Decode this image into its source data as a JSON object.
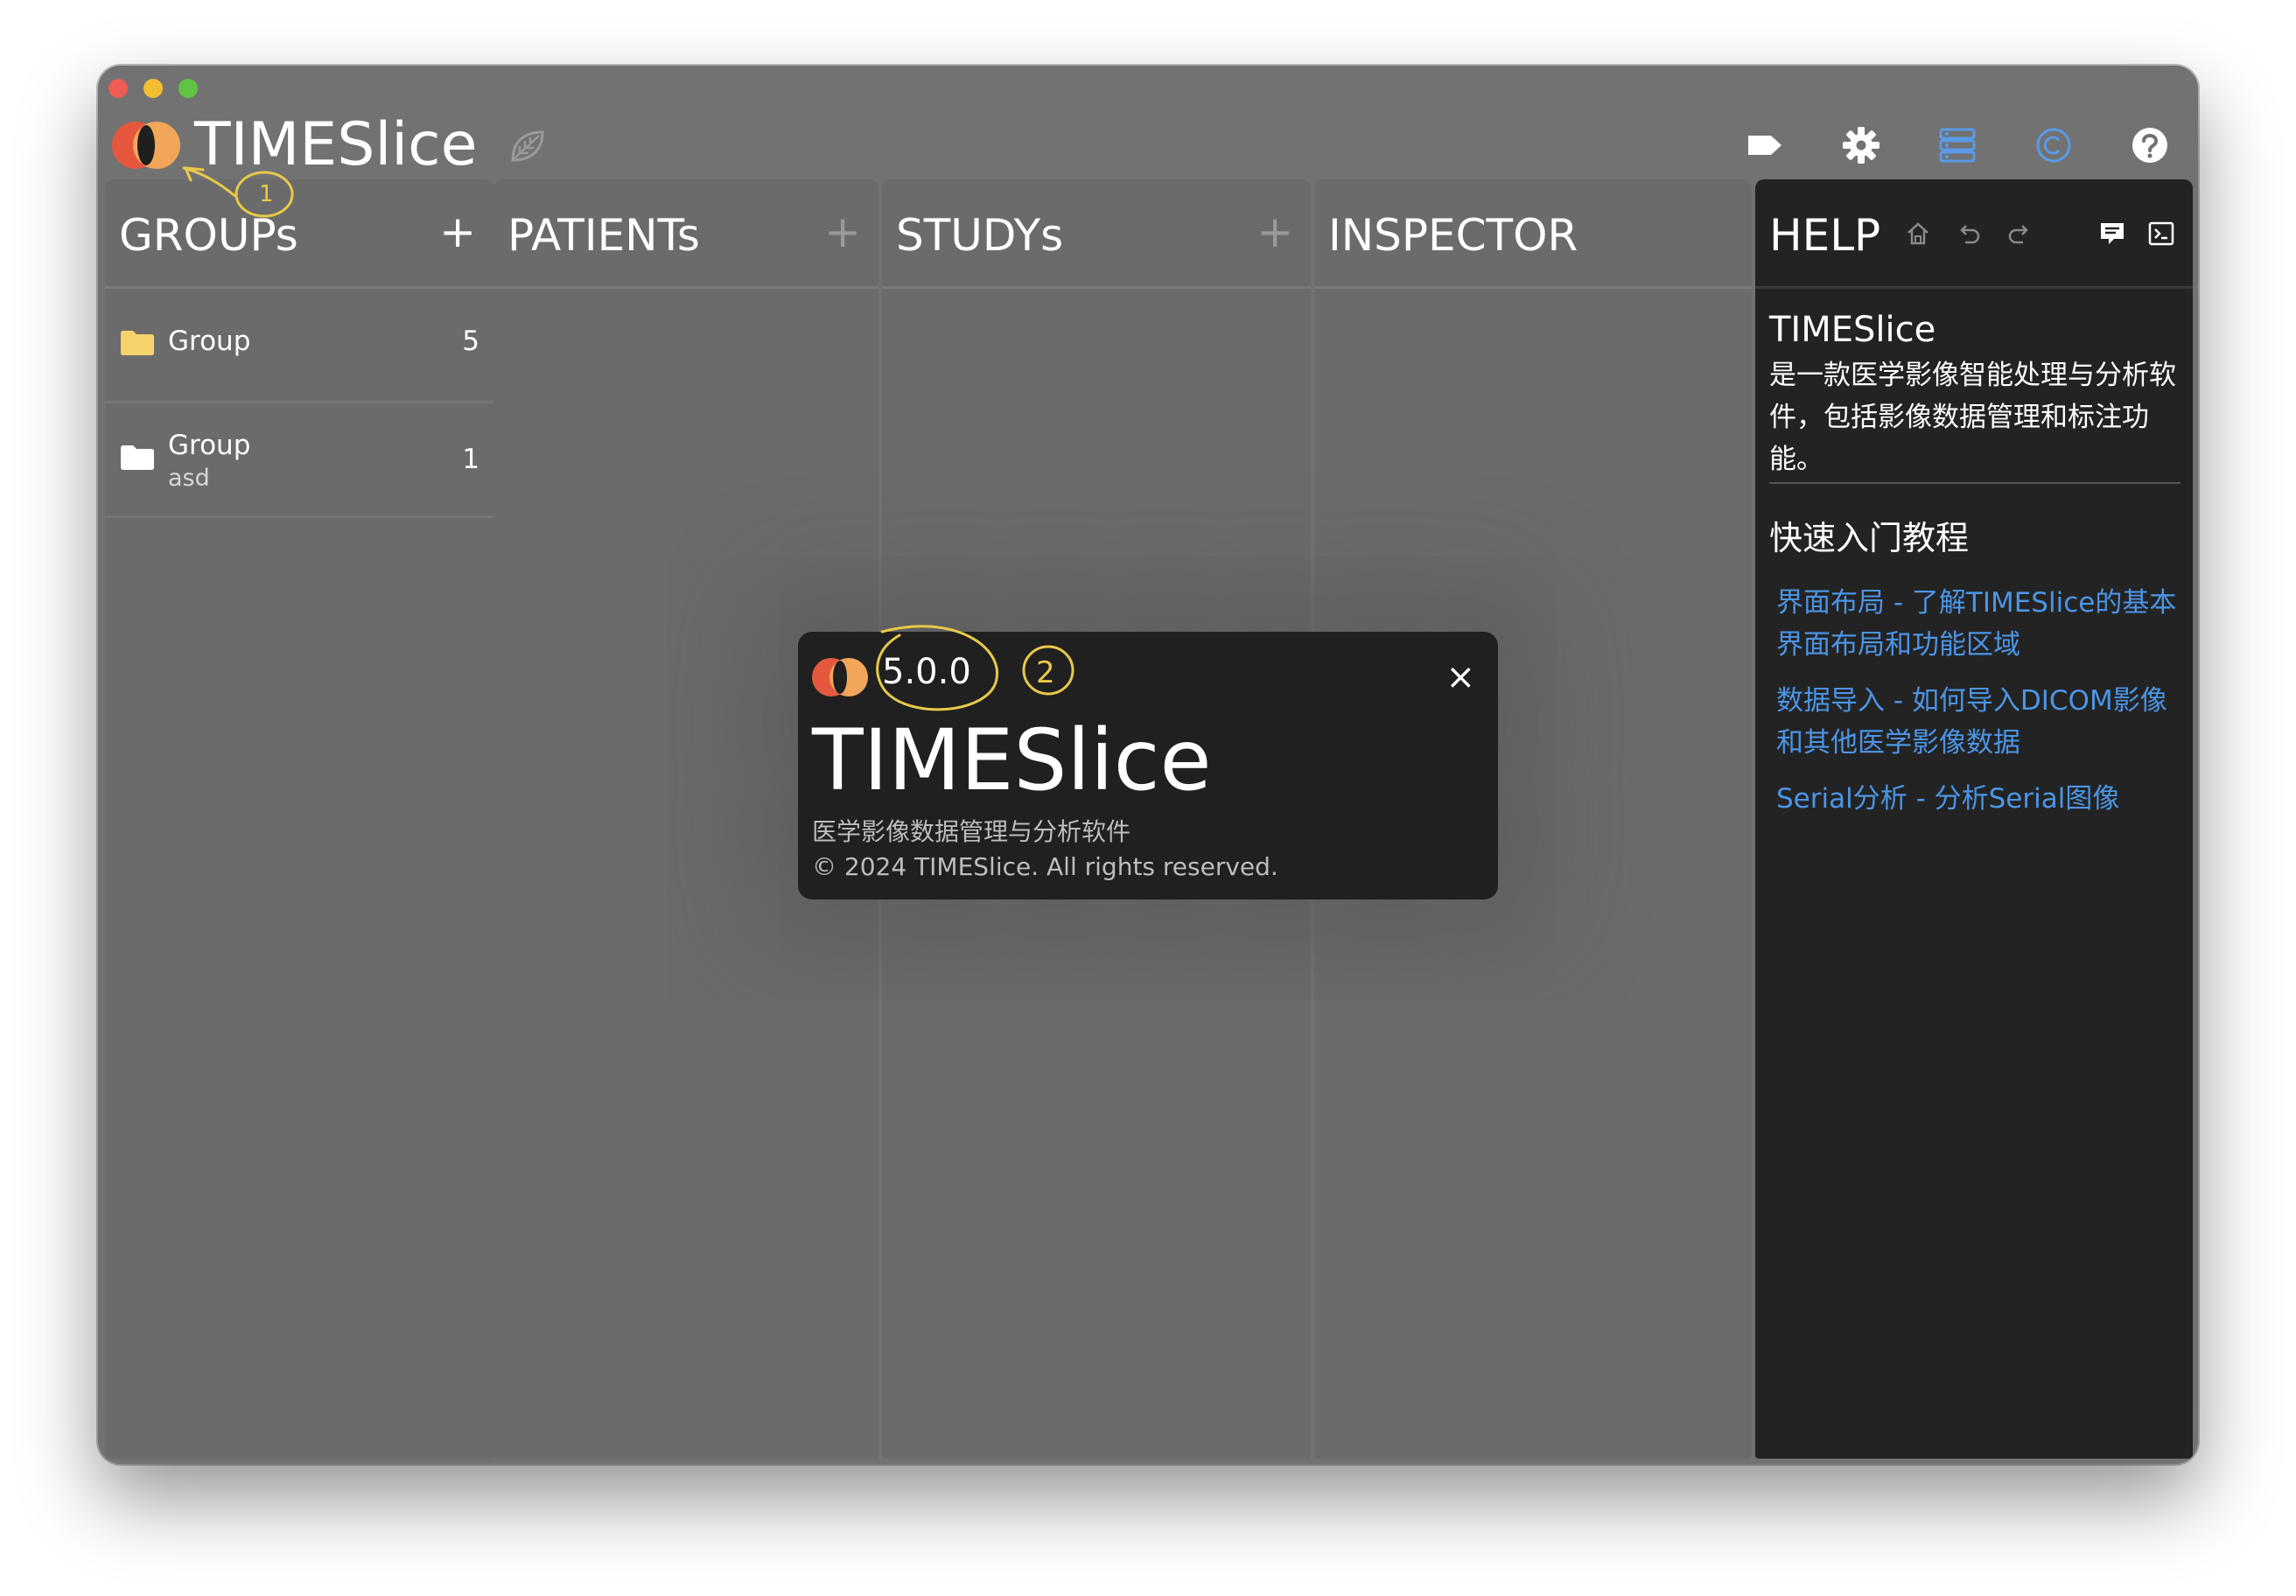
{
  "app": {
    "title": "TIMESlice"
  },
  "toolbar": {
    "items": [
      {
        "icon": "tag-icon"
      },
      {
        "icon": "gear-icon"
      },
      {
        "icon": "server-icon"
      },
      {
        "icon": "copyright-icon"
      },
      {
        "icon": "help-icon"
      }
    ]
  },
  "columns": {
    "groups": {
      "title": "GROUPs",
      "add": "+"
    },
    "patients": {
      "title": "PATIENTs",
      "add": "+"
    },
    "studys": {
      "title": "STUDYs",
      "add": "+"
    },
    "inspector": {
      "title": "INSPECTOR"
    }
  },
  "groups": [
    {
      "name": "Group",
      "count": "5",
      "folder_color": "#f7d36b"
    },
    {
      "name": "Group",
      "sub": "asd",
      "count": "1",
      "folder_color": "#ffffff"
    }
  ],
  "help": {
    "title": "HELP",
    "app_name": "TIMESlice",
    "description": "是一款医学影像智能处理与分析软件，包括影像数据管理和标注功能。",
    "quickstart_title": "快速入门教程",
    "links": [
      "界面布局 - 了解TIMESlice的基本界面布局和功能区域",
      "数据导入 - 如何导入DICOM影像和其他医学影像数据",
      "Serial分析 - 分析Serial图像"
    ]
  },
  "about": {
    "version": "5.0.0",
    "name": "TIMESlice",
    "subtitle": "医学影像数据管理与分析软件",
    "copyright": "© 2024 TIMESlice. All rights reserved.",
    "close": "×"
  },
  "annotations": {
    "mark1": "1",
    "mark2": "2"
  },
  "colors": {
    "window_bg": "#727272",
    "column_bg": "#6b6b6b",
    "help_bg": "#232323",
    "link": "#4b95e6",
    "accent_blue": "#5a9ae8",
    "logo_red": "#e5583e",
    "logo_orange": "#f2a65a",
    "annotation": "#e8c84a"
  }
}
